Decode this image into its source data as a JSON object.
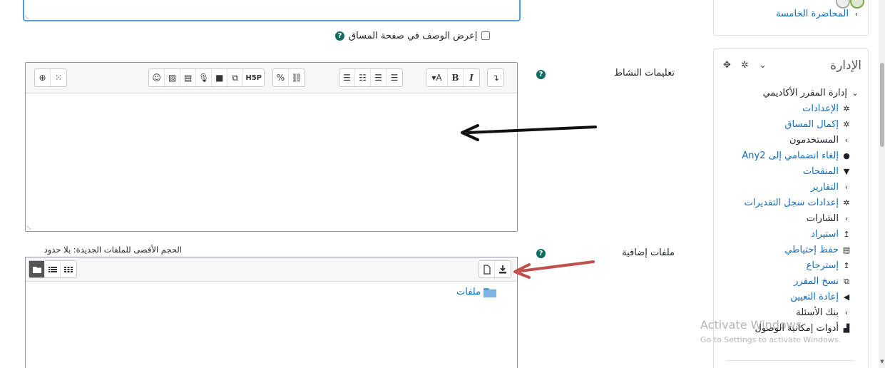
{
  "form": {
    "show_description_label": "إعرض الوصف في صفحة المساق",
    "activity_instructions_label": "تعليمات النشاط",
    "additional_files_label": "ملفات إضافية",
    "max_size_text": "الحجم الأقصى للملفات الجديدة: بلا حدود",
    "folder_label": "ملفات",
    "help_glyph": "?"
  },
  "toolbar": {
    "buttons": [
      "↴",
      "▾A",
      "B",
      "I",
      "☰",
      "☷",
      "☰",
      "☰",
      "%",
      "⛓",
      "☺",
      "▨",
      "▤",
      "🎙",
      "■",
      "⧉",
      "H5P",
      "⊕",
      "⁙"
    ]
  },
  "sidebar": {
    "lecture_link": "المحاضرة الخامسة",
    "admin_title": "الإدارة",
    "admin_controls": "✥ ✲ ⌄",
    "items": [
      {
        "label": "إدارة المقرر الأكاديمي",
        "icon": "⌄",
        "icon_name": "chevron-down-icon",
        "level": 0,
        "link": false
      },
      {
        "label": "الإعدادات",
        "icon": "✲",
        "icon_name": "gear-icon",
        "level": 1,
        "link": true
      },
      {
        "label": "إكمال المساق",
        "icon": "✲",
        "icon_name": "gear-icon",
        "level": 1,
        "link": true
      },
      {
        "label": "المستخدمون",
        "icon": "›",
        "icon_name": "chevron-icon",
        "level": 1,
        "link": false
      },
      {
        "label": "إلغاء انضمامي إلى Any2",
        "icon": "●",
        "icon_name": "user-icon",
        "level": 1,
        "link": true
      },
      {
        "label": "المنقحات",
        "icon": "▼",
        "icon_name": "filter-icon",
        "level": 1,
        "link": true
      },
      {
        "label": "التقارير",
        "icon": "›",
        "icon_name": "chevron-icon",
        "level": 1,
        "link": true
      },
      {
        "label": "إعدادات سجل التقديرات",
        "icon": "✲",
        "icon_name": "gear-icon",
        "level": 1,
        "link": true
      },
      {
        "label": "الشارات",
        "icon": "›",
        "icon_name": "chevron-icon",
        "level": 1,
        "link": false
      },
      {
        "label": "استيراد",
        "icon": "↥",
        "icon_name": "upload-icon",
        "level": 1,
        "link": true
      },
      {
        "label": "حفظ إحتياطي",
        "icon": "▤",
        "icon_name": "file-icon",
        "level": 1,
        "link": true
      },
      {
        "label": "إسترجاع",
        "icon": "↥",
        "icon_name": "upload-icon",
        "level": 1,
        "link": true
      },
      {
        "label": "نسخ المقرر",
        "icon": "⧉",
        "icon_name": "copy-icon",
        "level": 1,
        "link": true
      },
      {
        "label": "إعادة التعيين",
        "icon": "◀",
        "icon_name": "arrow-left-icon",
        "level": 1,
        "link": true
      },
      {
        "label": "بنك الأسئلة",
        "icon": "›",
        "icon_name": "chevron-icon",
        "level": 1,
        "link": false
      },
      {
        "label": "أدوات إمكانية الوصول",
        "icon": "▟",
        "icon_name": "chart-icon",
        "level": 1,
        "link": false
      }
    ]
  },
  "watermark": {
    "line1": "Activate Windows",
    "line2": "Go to Settings to activate Windows."
  },
  "colors": {
    "link": "#0f6cbf",
    "help": "#0f6b5f",
    "arrow_black": "#111111",
    "arrow_red": "#c0504d"
  }
}
